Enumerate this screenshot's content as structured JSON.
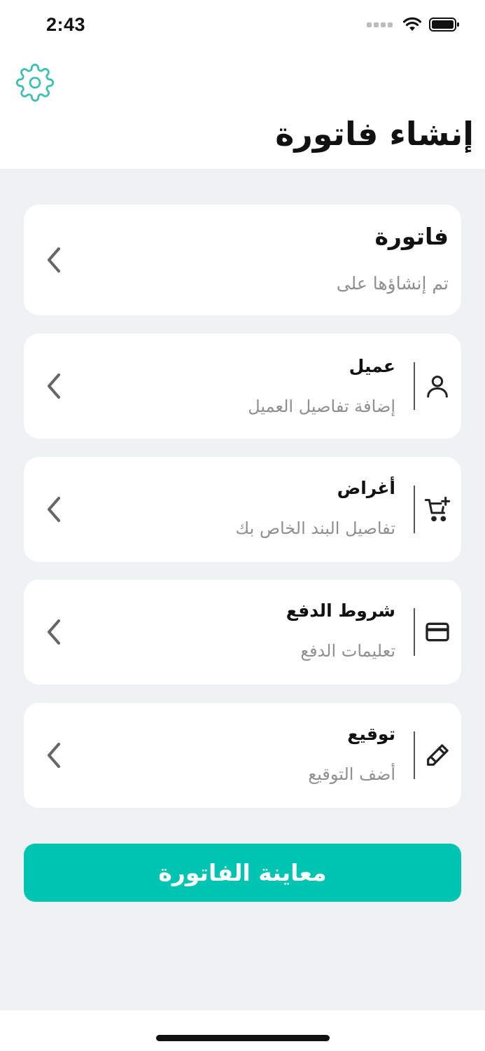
{
  "status_bar": {
    "time": "2:43"
  },
  "header": {
    "title": "إنشاء فاتورة"
  },
  "invoice_card": {
    "title": "فاتورة",
    "subtitle": "تم إنشاؤها على"
  },
  "cards": [
    {
      "title": "عميل",
      "subtitle": "إضافة تفاصيل العميل",
      "icon": "user-icon"
    },
    {
      "title": "أغراض",
      "subtitle": "تفاصيل البند الخاص بك",
      "icon": "cart-plus-icon"
    },
    {
      "title": "شروط الدفع",
      "subtitle": "تعليمات الدفع",
      "icon": "credit-card-icon"
    },
    {
      "title": "توقيع",
      "subtitle": "أضف التوقيع",
      "icon": "pen-icon"
    }
  ],
  "preview_button": {
    "label": "معاينة الفاتورة"
  },
  "colors": {
    "accent": "#00c4b2",
    "background": "#eff2f3",
    "settings_icon": "#3fbfae"
  }
}
